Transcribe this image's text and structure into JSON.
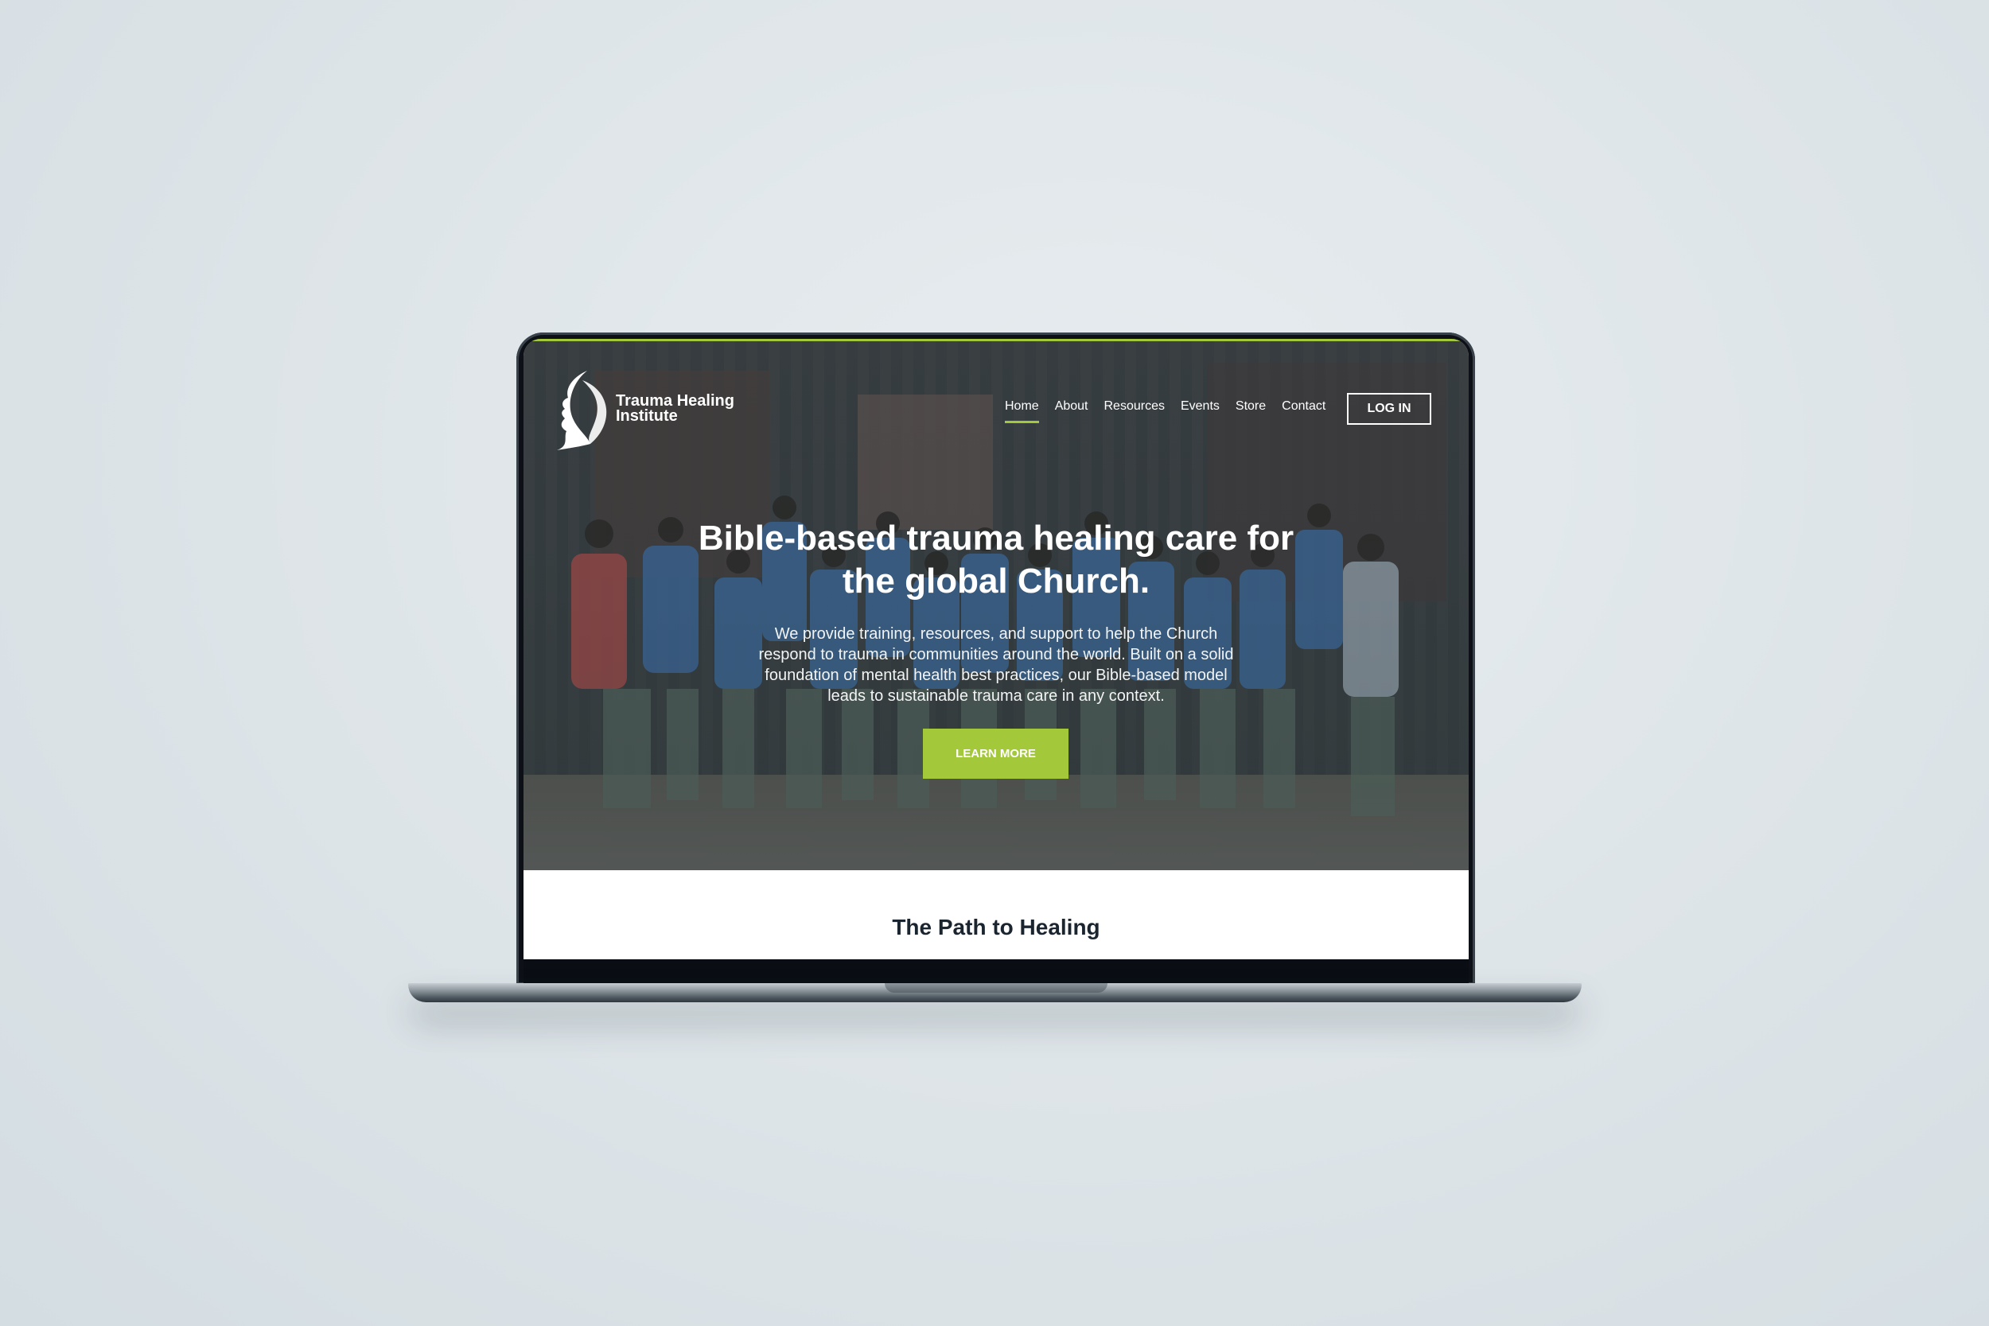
{
  "brand": {
    "name_line1": "Trauma Healing",
    "name_line2": "Institute",
    "logo_icon": "profile-face-icon",
    "accent_color": "#a3c93a"
  },
  "nav": {
    "items": [
      {
        "label": "Home",
        "active": true
      },
      {
        "label": "About"
      },
      {
        "label": "Resources"
      },
      {
        "label": "Events"
      },
      {
        "label": "Store"
      },
      {
        "label": "Contact"
      }
    ],
    "login_label": "LOG IN"
  },
  "hero": {
    "title": "Bible-based trauma healing care for the global Church.",
    "body": "We provide training, resources, and support to help the Church respond to trauma in communities around the world. Built on a solid foundation of mental health best practices, our Bible-based model leads to sustainable trauma care in any context.",
    "cta_label": "LEARN MORE"
  },
  "section": {
    "title": "The Path to Healing"
  }
}
